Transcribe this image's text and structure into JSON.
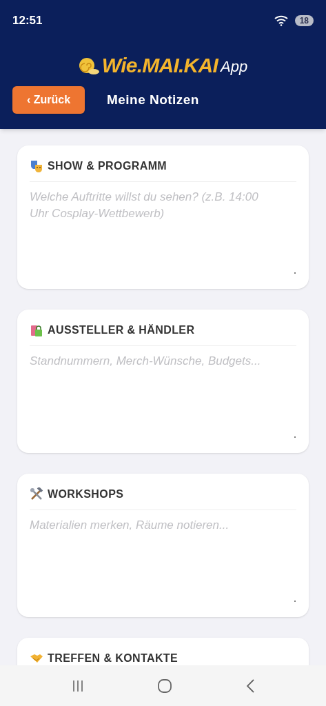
{
  "status_bar": {
    "time": "12:51",
    "battery": "18"
  },
  "header": {
    "logo": "Wie.MAI.KAI",
    "logo_suffix": "App",
    "back_button": "‹ Zurück",
    "title": "Meine Notizen"
  },
  "sections": [
    {
      "title": "SHOW & PROGRAMM",
      "placeholder": "Welche Auftritte willst du sehen? (z.B. 14:00 Uhr Cosplay-Wettbewerb)"
    },
    {
      "title": "AUSSTELLER & HÄNDLER",
      "placeholder": "Standnummern, Merch-Wünsche, Budgets..."
    },
    {
      "title": "WORKSHOPS",
      "placeholder": "Materialien merken, Räume notieren..."
    },
    {
      "title": "TREFFEN & KONTAKTE"
    }
  ]
}
